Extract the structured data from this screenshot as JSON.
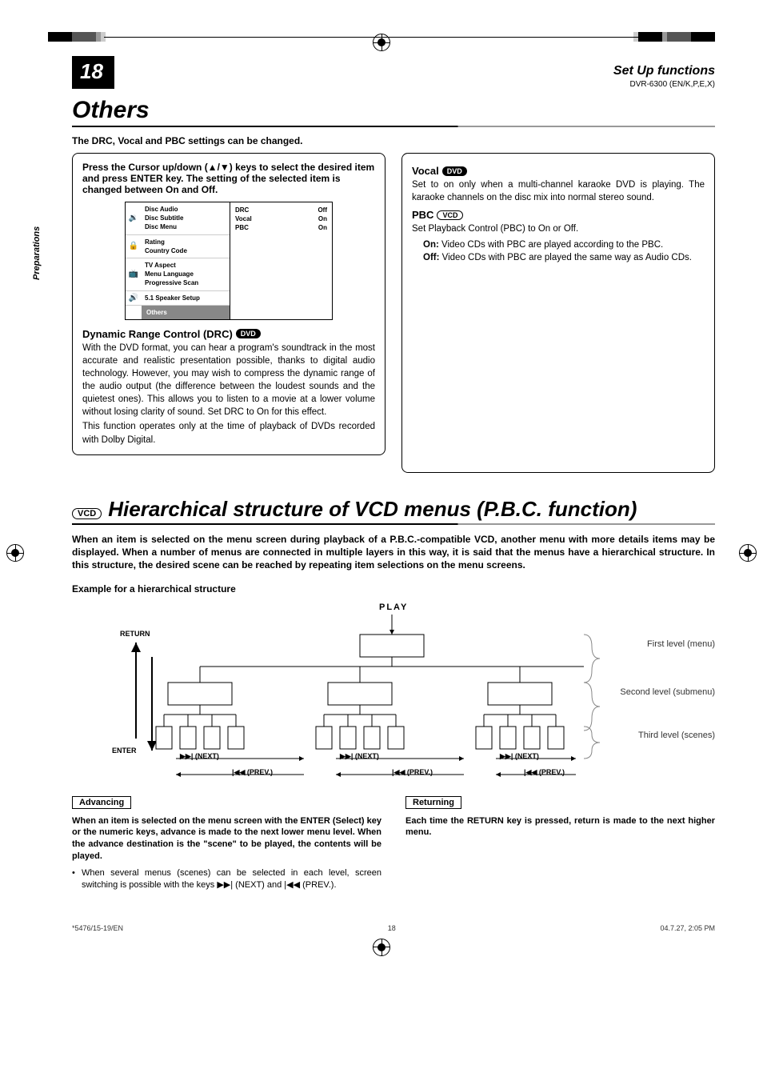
{
  "page_number": "18",
  "header": {
    "section": "Set Up functions",
    "model": "DVR-6300 (EN/K,P,E,X)"
  },
  "side_tab": "Preparations",
  "others": {
    "title": "Others",
    "intro": "The DRC, Vocal and PBC settings can be changed.",
    "left_box": {
      "instruction": "Press the Cursor up/down (▲/▼) keys to select the desired item and press ENTER key. The setting of the selected item is changed between On and Off.",
      "osd": {
        "rows": [
          [
            "Disc Audio",
            "Disc Subtitle",
            "Disc Menu"
          ],
          [
            "Rating",
            "Country Code"
          ],
          [
            "TV Aspect",
            "Menu Language",
            "Progressive Scan"
          ],
          [
            "5.1 Speaker Setup"
          ],
          [
            "Others"
          ]
        ],
        "right": [
          {
            "k": "DRC",
            "v": "Off"
          },
          {
            "k": "Vocal",
            "v": "On"
          },
          {
            "k": "PBC",
            "v": "On"
          }
        ]
      },
      "drc_head": "Dynamic Range Control (DRC)",
      "drc_badge": "DVD",
      "drc_body1": "With the DVD format, you can hear a program's soundtrack in the most accurate and realistic presentation possible, thanks to digital audio technology. However, you may wish to compress the dynamic range of the audio output (the difference between the loudest sounds and the quietest ones). This allows you to listen to a movie at a lower volume without losing clarity of sound. Set DRC to On for this effect.",
      "drc_body2": "This function operates only at the time of playback of DVDs recorded with Dolby Digital."
    },
    "right_box": {
      "vocal_head": "Vocal",
      "vocal_badge": "DVD",
      "vocal_body": "Set to on only when a multi-channel karaoke DVD is playing. The karaoke channels on the disc mix into normal stereo sound.",
      "pbc_head": "PBC",
      "pbc_badge": "VCD",
      "pbc_body": "Set Playback Control (PBC) to On or Off.",
      "pbc_on": "On:",
      "pbc_on_txt": " Video CDs with PBC are played according to the PBC.",
      "pbc_off": "Off:",
      "pbc_off_txt": " Video CDs with PBC are played the same way as Audio CDs."
    }
  },
  "hier": {
    "badge": "VCD",
    "title": "Hierarchical structure of VCD menus (P.B.C. function)",
    "intro": "When an item is selected on the menu screen during playback of a P.B.C.-compatible VCD, another menu with more details items may be displayed. When a number of menus are connected in multiple layers in this way, it is said that the menus have a hierarchical structure. In this structure, the desired scene can be reached by repeating item selections on the menu screens.",
    "example": "Example for a hierarchical structure",
    "diagram": {
      "play": "PLAY",
      "return": "RETURN",
      "enter": "ENTER",
      "next": "▶▶| (NEXT)",
      "prev": "|◀◀ (PREV.)",
      "level1": "First level (menu)",
      "level2": "Second level (submenu)",
      "level3": "Third level (scenes)"
    },
    "adv": {
      "label": "Advancing",
      "text": "When an item is selected on the menu screen with the ENTER (Select) key or the numeric keys, advance is made to the next lower menu level. When the advance destination is the \"scene\" to be played, the contents will be played.",
      "bullet": "When several menus (scenes) can be selected in each level, screen switching is possible with the keys ▶▶| (NEXT) and |◀◀ (PREV.)."
    },
    "ret": {
      "label": "Returning",
      "text": "Each time the RETURN key is pressed, return is made to the next higher menu."
    }
  },
  "footer": {
    "left": "*5476/15-19/EN",
    "center": "18",
    "right": "04.7.27, 2:05 PM"
  }
}
